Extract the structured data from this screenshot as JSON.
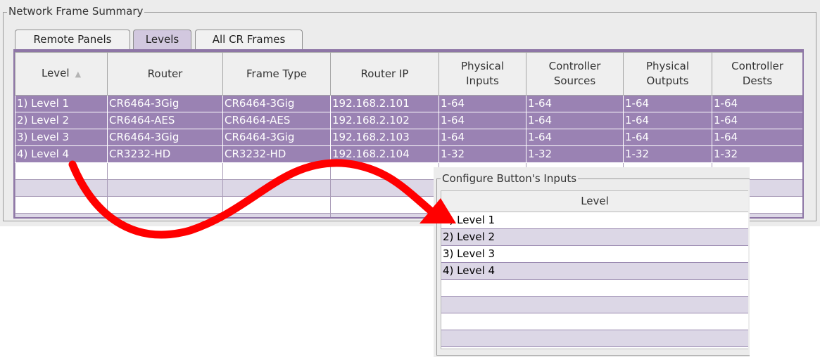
{
  "network_frame_summary": {
    "title": "Network Frame Summary",
    "tabs": [
      {
        "label": "Remote Panels",
        "selected": false
      },
      {
        "label": "Levels",
        "selected": true
      },
      {
        "label": "All CR Frames",
        "selected": false
      }
    ],
    "table": {
      "columns": [
        "Level",
        "Router",
        "Frame Type",
        "Router IP",
        "Physical Inputs",
        "Controller Sources",
        "Physical Outputs",
        "Controller Dests"
      ],
      "sort_indicator": "▲",
      "rows": [
        [
          "1) Level 1",
          "CR6464-3Gig",
          "CR6464-3Gig",
          "192.168.2.101",
          "1-64",
          "1-64",
          "1-64",
          "1-64"
        ],
        [
          "2) Level 2",
          "CR6464-AES",
          "CR6464-AES",
          "192.168.2.102",
          "1-64",
          "1-64",
          "1-64",
          "1-64"
        ],
        [
          "3) Level 3",
          "CR6464-3Gig",
          "CR6464-3Gig",
          "192.168.2.103",
          "1-64",
          "1-64",
          "1-64",
          "1-64"
        ],
        [
          "4) Level 4",
          "CR3232-HD",
          "CR3232-HD",
          "192.168.2.104",
          "1-32",
          "1-32",
          "1-32",
          "1-32"
        ]
      ]
    }
  },
  "configure_inputs": {
    "title": "Configure Button's Inputs",
    "column": "Level",
    "rows": [
      "1) Level 1",
      "2) Level 2",
      "3) Level 3",
      "4) Level 4"
    ]
  },
  "colors": {
    "selected_row": "#9a82b3",
    "alt_row": "#dcd7e6",
    "selected_tab": "#d2c8df",
    "arrow": "#ff0000"
  },
  "icons": {
    "sort": "sort-ascending-icon",
    "annotation": "curved-arrow-icon"
  }
}
